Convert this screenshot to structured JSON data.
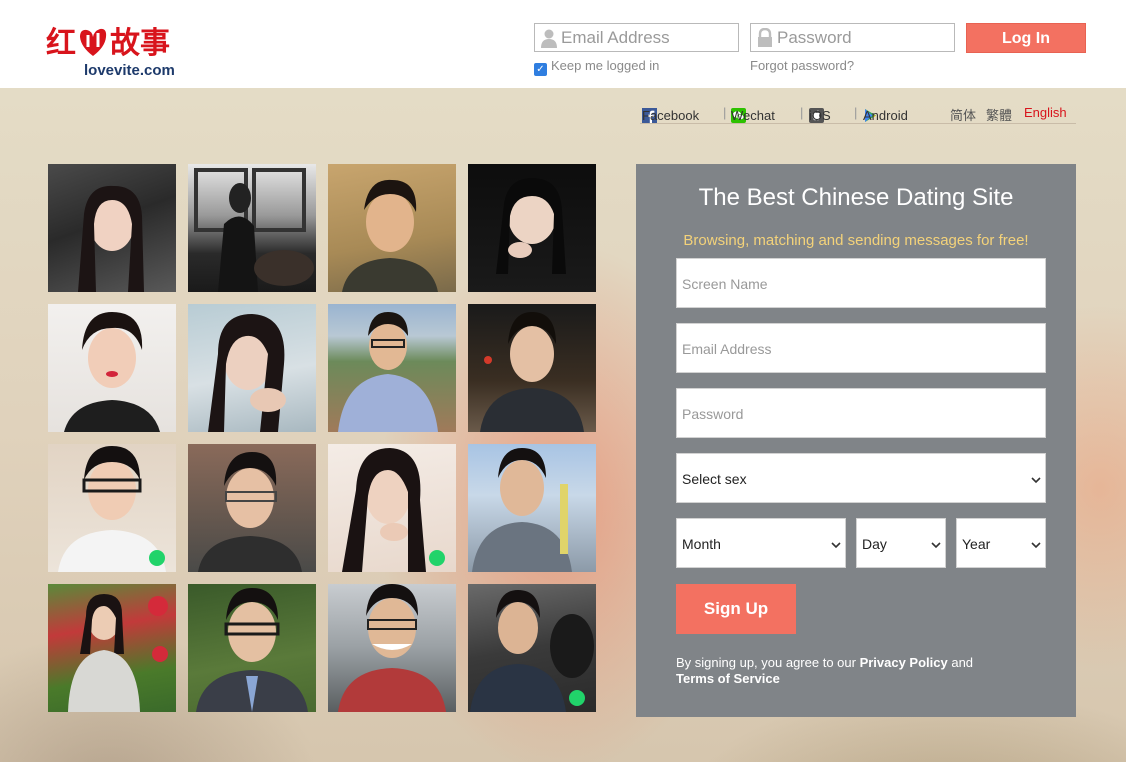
{
  "header": {
    "logo_cn": "红故事",
    "logo_url": "lovevite.com",
    "email_placeholder": "Email Address",
    "password_placeholder": "Password",
    "login_label": "Log In",
    "keep_logged_in": "Keep me logged in",
    "forgot_password": "Forgot password?"
  },
  "social": {
    "facebook": "Facebook",
    "wechat": "Wechat",
    "ios": "iOS",
    "android": "Android",
    "sep": "|",
    "lang_simplified": "简体",
    "lang_traditional": "繁體",
    "lang_english": "English"
  },
  "signup": {
    "title": "The Best Chinese Dating Site",
    "subtitle": "Browsing, matching and sending messages for free!",
    "screen_name_placeholder": "Screen Name",
    "email_placeholder": "Email Address",
    "password_placeholder": "Password",
    "sex_select": "Select sex",
    "month_select": "Month",
    "day_select": "Day",
    "year_select": "Year",
    "signup_label": "Sign Up",
    "terms_prefix": "By signing up, you agree to our ",
    "privacy_policy": "Privacy Policy",
    "terms_and": " and ",
    "terms_of_service": "Terms of Service"
  },
  "colors": {
    "accent": "#f37161",
    "brand_red": "#d8141c",
    "online": "#21d36a",
    "panel": "#808488",
    "subtitle": "#f3d27a"
  },
  "profiles": [
    {
      "icon": "profile-photo-woman",
      "online": false
    },
    {
      "icon": "profile-photo-woman",
      "online": false
    },
    {
      "icon": "profile-photo-man",
      "online": false
    },
    {
      "icon": "profile-photo-woman",
      "online": false
    },
    {
      "icon": "profile-photo-woman",
      "online": false
    },
    {
      "icon": "profile-photo-woman",
      "online": false
    },
    {
      "icon": "profile-photo-man",
      "online": false
    },
    {
      "icon": "profile-photo-man",
      "online": false
    },
    {
      "icon": "profile-photo-man",
      "online": true
    },
    {
      "icon": "profile-photo-man",
      "online": false
    },
    {
      "icon": "profile-photo-woman",
      "online": true
    },
    {
      "icon": "profile-photo-man",
      "online": false
    },
    {
      "icon": "profile-photo-woman",
      "online": false
    },
    {
      "icon": "profile-photo-man",
      "online": false
    },
    {
      "icon": "profile-photo-man",
      "online": false
    },
    {
      "icon": "profile-photo-man",
      "online": true
    }
  ]
}
